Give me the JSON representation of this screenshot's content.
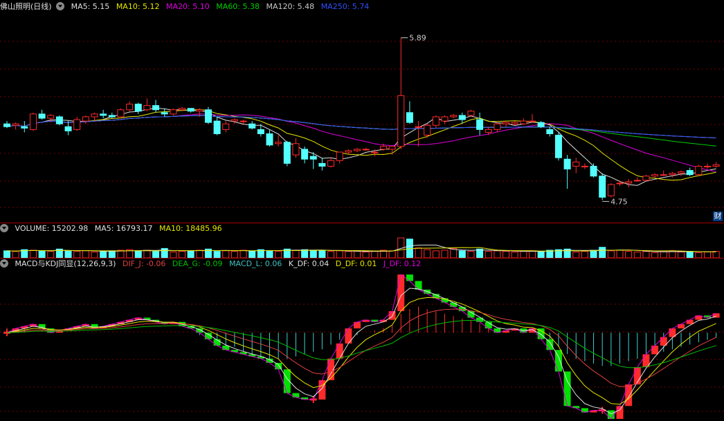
{
  "main_header": {
    "title": "佛山照明(日线)",
    "ma": [
      {
        "label": "MA5: 5.15",
        "color": "#e0e0e0"
      },
      {
        "label": "MA10: 5.12",
        "color": "#e8e800"
      },
      {
        "label": "MA20: 5.10",
        "color": "#e000e0"
      },
      {
        "label": "MA60: 5.38",
        "color": "#00d000"
      },
      {
        "label": "MA120: 5.48",
        "color": "#c8c8c8"
      },
      {
        "label": "MA250: 5.74",
        "color": "#3050ff"
      }
    ]
  },
  "volume_header": {
    "label": "VOLUME: 15202.98",
    "ma5": "MA5: 16793.17",
    "ma10": "MA10: 18485.96"
  },
  "macd_header": {
    "title": "MACD与KDJ同显(12,26,9,3)",
    "items": [
      {
        "label": "DIF_J: -0.06",
        "color": "#e04040"
      },
      {
        "label": "DEA_G: -0.09",
        "color": "#00c000"
      },
      {
        "label": "MACD_L: 0.06",
        "color": "#40c0c0"
      },
      {
        "label": "K_DF: 0.04",
        "color": "#e0e0e0"
      },
      {
        "label": "D_DF: 0.01",
        "color": "#e8e800"
      },
      {
        "label": "J_DF: 0.12",
        "color": "#e000e0"
      }
    ]
  },
  "side_tag": "财",
  "colors": {
    "up": "#ff2a2a",
    "down": "#54ffff",
    "green": "#00e000",
    "grid": "#7a0000"
  },
  "chart_data": {
    "type": "candlestick",
    "high_annotation": "5.89",
    "low_annotation": "4.75",
    "ylim": [
      4.6,
      6.05
    ],
    "candles": [
      [
        5.28,
        5.3,
        5.25,
        5.26
      ],
      [
        5.27,
        5.29,
        5.24,
        5.28
      ],
      [
        5.26,
        5.3,
        5.22,
        5.25
      ],
      [
        5.24,
        5.36,
        5.23,
        5.35
      ],
      [
        5.35,
        5.38,
        5.31,
        5.32
      ],
      [
        5.32,
        5.35,
        5.29,
        5.34
      ],
      [
        5.33,
        5.34,
        5.27,
        5.28
      ],
      [
        5.26,
        5.3,
        5.2,
        5.23
      ],
      [
        5.24,
        5.33,
        5.23,
        5.31
      ],
      [
        5.3,
        5.34,
        5.28,
        5.33
      ],
      [
        5.33,
        5.36,
        5.3,
        5.35
      ],
      [
        5.35,
        5.38,
        5.32,
        5.34
      ],
      [
        5.34,
        5.36,
        5.32,
        5.33
      ],
      [
        5.33,
        5.39,
        5.32,
        5.38
      ],
      [
        5.38,
        5.44,
        5.37,
        5.42
      ],
      [
        5.42,
        5.43,
        5.35,
        5.37
      ],
      [
        5.38,
        5.46,
        5.37,
        5.41
      ],
      [
        5.41,
        5.45,
        5.36,
        5.38
      ],
      [
        5.36,
        5.39,
        5.33,
        5.35
      ],
      [
        5.35,
        5.39,
        5.34,
        5.38
      ],
      [
        5.38,
        5.4,
        5.37,
        5.39
      ],
      [
        5.39,
        5.39,
        5.36,
        5.37
      ],
      [
        5.37,
        5.39,
        5.33,
        5.38
      ],
      [
        5.38,
        5.4,
        5.28,
        5.29
      ],
      [
        5.3,
        5.33,
        5.2,
        5.21
      ],
      [
        5.24,
        5.3,
        5.22,
        5.28
      ],
      [
        5.3,
        5.32,
        5.28,
        5.31
      ],
      [
        5.3,
        5.31,
        5.28,
        5.3
      ],
      [
        5.28,
        5.3,
        5.24,
        5.25
      ],
      [
        5.24,
        5.28,
        5.19,
        5.21
      ],
      [
        5.21,
        5.24,
        5.12,
        5.13
      ],
      [
        5.14,
        5.2,
        5.12,
        5.15
      ],
      [
        5.15,
        5.16,
        4.98,
        5.0
      ],
      [
        5.06,
        5.18,
        5.04,
        5.14
      ],
      [
        5.1,
        5.12,
        5.0,
        5.03
      ],
      [
        5.05,
        5.08,
        4.96,
        5.03
      ],
      [
        5.0,
        5.04,
        4.95,
        4.98
      ],
      [
        4.98,
        5.04,
        4.97,
        5.02
      ],
      [
        5.02,
        5.08,
        5.0,
        5.08
      ],
      [
        5.08,
        5.1,
        5.06,
        5.09
      ],
      [
        5.09,
        5.11,
        5.08,
        5.1
      ],
      [
        5.1,
        5.11,
        5.09,
        5.1
      ],
      [
        5.08,
        5.1,
        5.05,
        5.08
      ],
      [
        5.1,
        5.14,
        5.09,
        5.12
      ],
      [
        5.1,
        5.12,
        5.06,
        5.12
      ],
      [
        5.12,
        5.89,
        5.1,
        5.48
      ],
      [
        5.36,
        5.44,
        5.28,
        5.29
      ],
      [
        5.26,
        5.3,
        5.12,
        5.26
      ],
      [
        5.2,
        5.28,
        5.18,
        5.27
      ],
      [
        5.27,
        5.34,
        5.25,
        5.33
      ],
      [
        5.3,
        5.34,
        5.28,
        5.33
      ],
      [
        5.33,
        5.35,
        5.32,
        5.34
      ],
      [
        5.34,
        5.36,
        5.28,
        5.31
      ],
      [
        5.34,
        5.38,
        5.33,
        5.37
      ],
      [
        5.31,
        5.36,
        5.2,
        5.24
      ],
      [
        5.22,
        5.26,
        5.2,
        5.24
      ],
      [
        5.24,
        5.29,
        5.22,
        5.28
      ],
      [
        5.28,
        5.3,
        5.26,
        5.29
      ],
      [
        5.28,
        5.3,
        5.27,
        5.29
      ],
      [
        5.28,
        5.32,
        5.28,
        5.3
      ],
      [
        5.3,
        5.35,
        5.29,
        5.3
      ],
      [
        5.29,
        5.3,
        5.25,
        5.26
      ],
      [
        5.24,
        5.26,
        5.19,
        5.21
      ],
      [
        5.2,
        5.22,
        5.02,
        5.04
      ],
      [
        5.03,
        5.06,
        4.82,
        4.96
      ],
      [
        4.98,
        5.04,
        4.93,
        5.01
      ],
      [
        4.98,
        5.0,
        4.96,
        4.98
      ],
      [
        4.98,
        5.0,
        4.9,
        4.91
      ],
      [
        4.91,
        4.93,
        4.74,
        4.76
      ],
      [
        4.77,
        4.86,
        4.76,
        4.85
      ],
      [
        4.86,
        4.88,
        4.84,
        4.86
      ],
      [
        4.86,
        4.89,
        4.83,
        4.87
      ],
      [
        4.88,
        4.9,
        4.87,
        4.88
      ],
      [
        4.88,
        4.92,
        4.87,
        4.91
      ],
      [
        4.91,
        4.93,
        4.9,
        4.92
      ],
      [
        4.92,
        4.95,
        4.91,
        4.92
      ],
      [
        4.92,
        4.94,
        4.9,
        4.93
      ],
      [
        4.93,
        4.95,
        4.91,
        4.94
      ],
      [
        4.95,
        4.97,
        4.91,
        4.92
      ],
      [
        4.92,
        4.99,
        4.91,
        4.98
      ],
      [
        4.98,
        5.0,
        4.96,
        4.98
      ],
      [
        4.98,
        5.01,
        4.97,
        4.99
      ]
    ],
    "volume_ylim": [
      0,
      40000
    ],
    "volume": [
      12000,
      11000,
      14000,
      13000,
      12000,
      11000,
      15000,
      12000,
      11000,
      12000,
      10000,
      11000,
      12000,
      13000,
      14000,
      12000,
      13000,
      11000,
      16000,
      10000,
      11000,
      12000,
      13000,
      15000,
      11000,
      12000,
      11000,
      13000,
      12000,
      14000,
      12000,
      11000,
      15000,
      13000,
      14000,
      13000,
      12000,
      11000,
      12000,
      11000,
      11000,
      10000,
      11000,
      13000,
      12000,
      34000,
      32000,
      17000,
      14000,
      12000,
      13000,
      16000,
      12000,
      11000,
      15000,
      11000,
      12000,
      11000,
      10000,
      11000,
      12000,
      11000,
      13000,
      14000,
      15000,
      10000,
      11000,
      13000,
      18000,
      12000,
      13000,
      11000,
      10000,
      11000,
      9000,
      11000,
      12000,
      10000,
      11000,
      9000,
      10000,
      11000
    ],
    "macd_ylim": [
      -0.4,
      0.28
    ],
    "macd_hist": [
      0.01,
      0.01,
      0.01,
      0.0,
      0.0,
      0.0,
      0.0,
      0.0,
      0.0,
      0.0,
      0.0,
      0.0,
      0.0,
      0.0,
      0.0,
      0.0,
      0.0,
      0.0,
      0.0,
      0.0,
      0.0,
      0.0,
      -0.005,
      -0.01,
      -0.02,
      -0.03,
      -0.03,
      -0.04,
      -0.045,
      -0.05,
      -0.055,
      -0.055,
      -0.055,
      -0.05,
      -0.045,
      -0.04,
      -0.035,
      -0.025,
      -0.015,
      -0.01,
      -0.005,
      0.0,
      0.005,
      0.01,
      0.015,
      0.04,
      0.05,
      0.055,
      0.05,
      0.045,
      0.04,
      0.035,
      0.03,
      0.025,
      0.02,
      0.012,
      0.008,
      0.005,
      0.0,
      0.0,
      0.0,
      -0.01,
      -0.02,
      -0.03,
      -0.045,
      -0.055,
      -0.06,
      -0.065,
      -0.07,
      -0.07,
      -0.065,
      -0.06,
      -0.055,
      -0.05,
      -0.045,
      -0.04,
      -0.035,
      -0.03,
      -0.025,
      -0.02,
      -0.015,
      -0.01
    ],
    "kdj_bars": [
      0.0,
      0.02,
      0.03,
      0.04,
      0.02,
      0.0,
      0.01,
      0.02,
      0.03,
      0.04,
      0.02,
      0.03,
      0.04,
      0.05,
      0.06,
      0.07,
      0.06,
      0.05,
      0.04,
      0.05,
      0.03,
      0.02,
      0.0,
      -0.03,
      -0.06,
      -0.08,
      -0.09,
      -0.1,
      -0.11,
      -0.12,
      -0.14,
      -0.17,
      -0.28,
      -0.3,
      -0.31,
      -0.31,
      -0.22,
      -0.12,
      -0.05,
      0.02,
      0.05,
      0.06,
      0.05,
      0.06,
      0.1,
      0.27,
      0.24,
      0.2,
      0.18,
      0.16,
      0.14,
      0.12,
      0.1,
      0.07,
      0.05,
      0.02,
      0.0,
      0.01,
      0.02,
      0.0,
      0.02,
      -0.03,
      -0.08,
      -0.18,
      -0.34,
      -0.35,
      -0.37,
      -0.36,
      -0.36,
      -0.4,
      -0.34,
      -0.24,
      -0.16,
      -0.1,
      -0.06,
      -0.02,
      0.02,
      0.04,
      0.06,
      0.08,
      0.07,
      0.09
    ]
  }
}
